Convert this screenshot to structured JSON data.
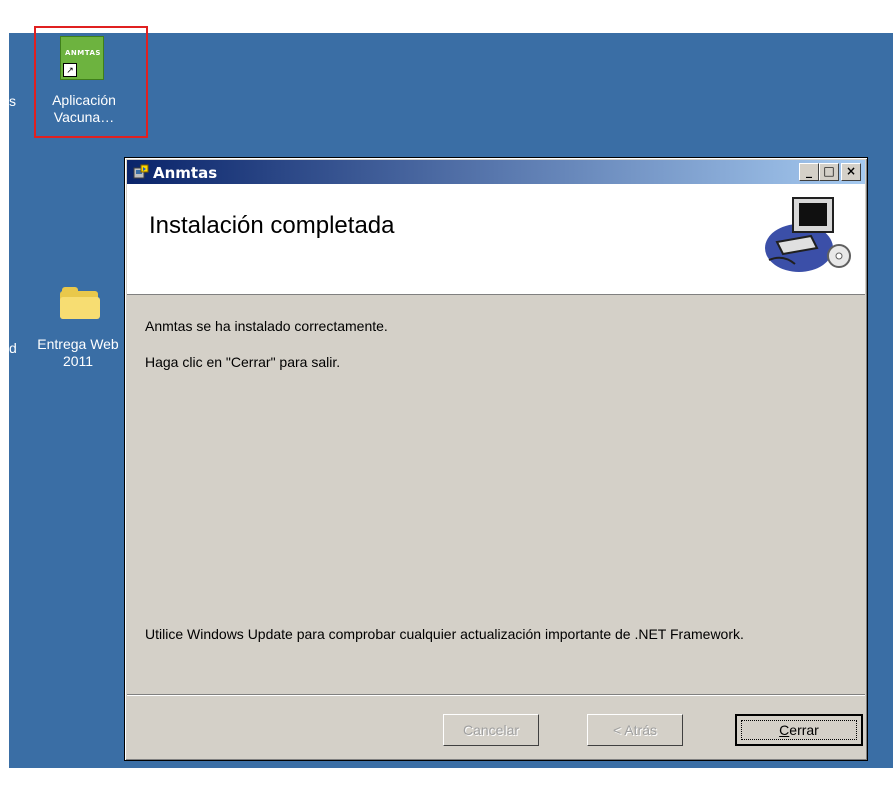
{
  "desktop": {
    "icons": [
      {
        "label_line1": "Aplicación",
        "label_line2": "Vacuna…",
        "icon": "app-shortcut-icon"
      },
      {
        "label_line1": "Entrega Web",
        "label_line2": "2011",
        "icon": "folder-icon"
      }
    ],
    "cut_text_left_1": "s",
    "cut_text_left_2": "d",
    "app_tile_text": "ANMTAS"
  },
  "window": {
    "title": "Anmtas",
    "controls": {
      "minimize": "_",
      "maximize": "□",
      "close": "×"
    },
    "header_title": "Instalación completada",
    "message_1": "Anmtas se ha instalado correctamente.",
    "message_2": "Haga clic en \"Cerrar\" para salir.",
    "footer_message": "Utilice Windows Update para comprobar cualquier actualización importante de .NET Framework.",
    "buttons": {
      "cancel": "Cancelar",
      "back": "< Atrás",
      "close_prefix": "",
      "close_accel": "C",
      "close_rest": "errar"
    }
  },
  "colors": {
    "desktop": "#3a6ea5",
    "titlebar_start": "#0a246a",
    "titlebar_end": "#a6caf0",
    "selection_box": "#e02020"
  }
}
